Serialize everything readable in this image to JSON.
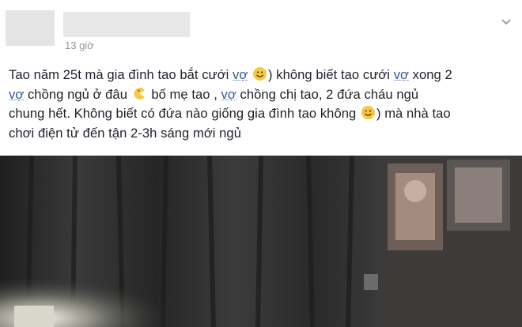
{
  "post": {
    "timestamp": "13 giờ",
    "lines": [
      {
        "a": "Tao năm 25t mà gia đình tao bắt cưới ",
        "l1": "vợ",
        "b": ") không biết tao cưới ",
        "l2": "vợ",
        "c": " xong 2"
      },
      {
        "l1": "vợ",
        "a": " chồng ngủ ở đâu ",
        "b": " bố mẹ tao , ",
        "l2": "vợ",
        "c": " chồng chị tao, 2 đứa cháu ngủ"
      },
      {
        "a": "chung hết. Không biết có đứa nào giống gia đình tao không ",
        "b": ") mà nhà tao"
      },
      {
        "a": "chơi điện tử đến tận 2-3h sáng mới ngủ"
      }
    ],
    "icons": {
      "smile": "smile-emoji-icon",
      "pacman": "pacman-emoji-icon",
      "wink": "wink-emoji-icon",
      "more": "more-options-icon"
    }
  }
}
